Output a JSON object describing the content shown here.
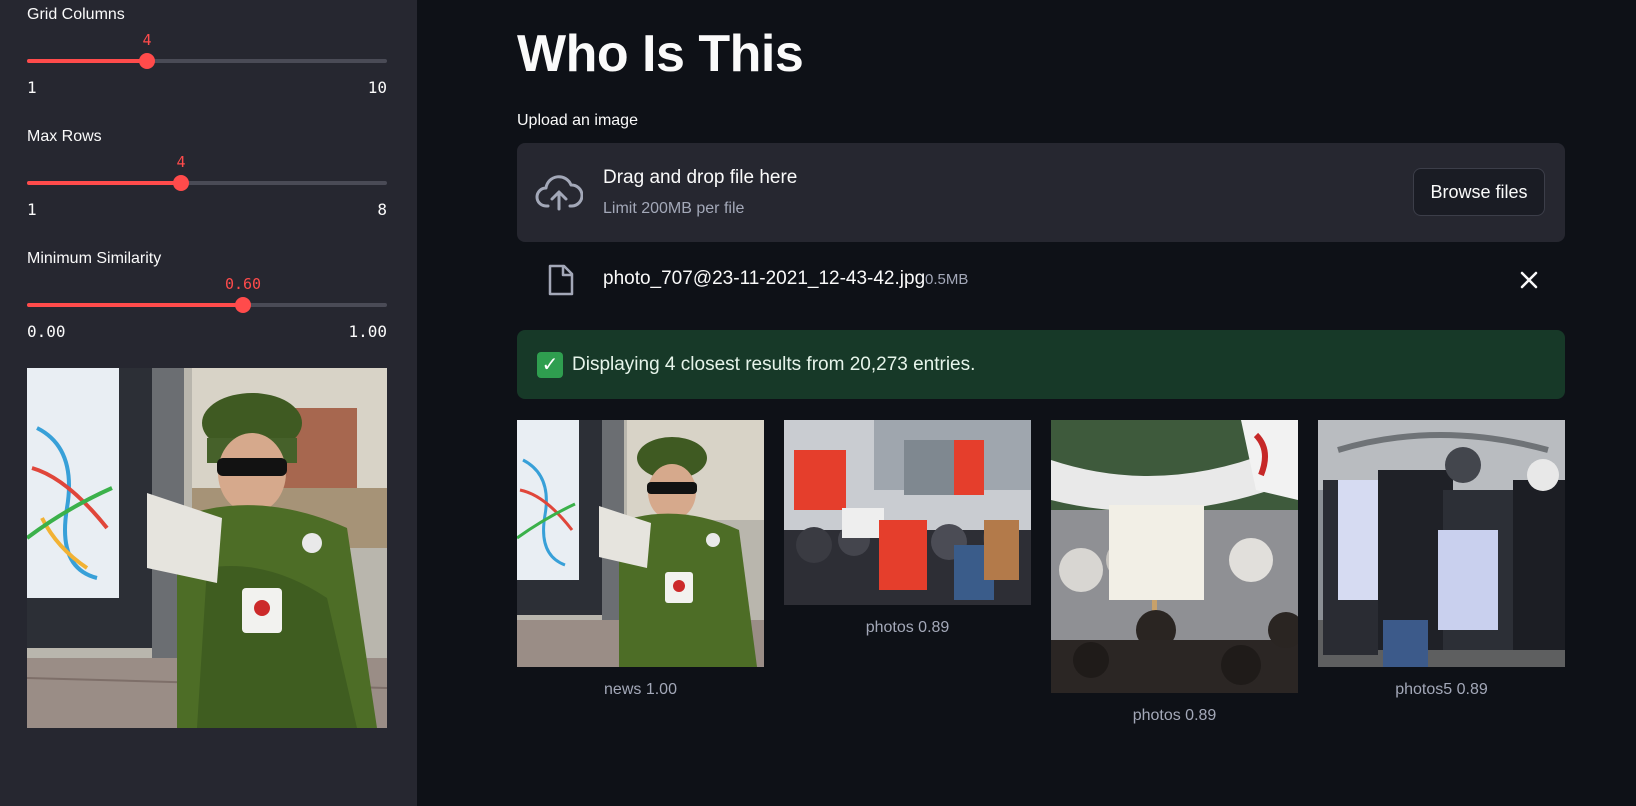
{
  "sidebar": {
    "sliders": [
      {
        "label": "Grid Columns",
        "value": "4",
        "min": "1",
        "max": "10",
        "fraction": 0.333
      },
      {
        "label": "Max Rows",
        "value": "4",
        "min": "1",
        "max": "8",
        "fraction": 0.4286
      },
      {
        "label": "Minimum Similarity",
        "value": "0.60",
        "min": "0.00",
        "max": "1.00",
        "fraction": 0.6
      }
    ]
  },
  "main": {
    "title": "Who Is This",
    "upload_label": "Upload an image",
    "dropzone": {
      "title": "Drag and drop file here",
      "limit": "Limit 200MB per file",
      "browse_label": "Browse files"
    },
    "file": {
      "name": "photo_707@23-11-2021_12-43-42.jpg",
      "size": "0.5MB"
    },
    "success": {
      "text": "Displaying 4 closest results from 20,273 entries."
    },
    "results": [
      {
        "caption": "news 1.00"
      },
      {
        "caption": "photos 0.89"
      },
      {
        "caption": "photos 0.89"
      },
      {
        "caption": "photos5 0.89"
      }
    ]
  },
  "colors": {
    "accent": "#ff4b4b",
    "sidebar_bg": "#262730",
    "app_bg": "#0e1117",
    "success_bg": "#173928"
  }
}
